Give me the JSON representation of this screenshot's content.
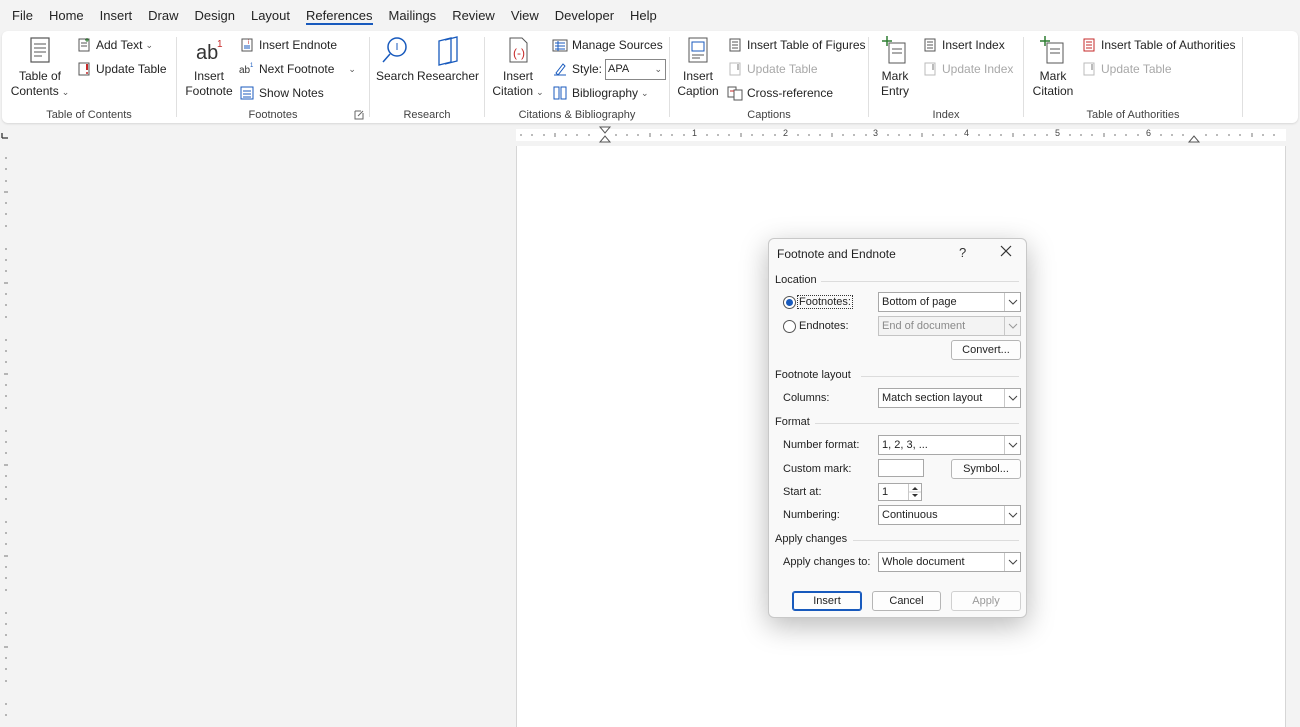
{
  "menu": {
    "items": [
      "File",
      "Home",
      "Insert",
      "Draw",
      "Design",
      "Layout",
      "References",
      "Mailings",
      "Review",
      "View",
      "Developer",
      "Help"
    ],
    "active": "References"
  },
  "ribbon": {
    "toc": {
      "label": "Table of Contents",
      "big_line1": "Table of",
      "big_line2": "Contents",
      "add_text": "Add Text",
      "update_table": "Update Table"
    },
    "footnotes": {
      "label": "Footnotes",
      "insert_line1": "Insert",
      "insert_line2": "Footnote",
      "insert_endnote": "Insert Endnote",
      "next_footnote": "Next Footnote",
      "show_notes": "Show Notes"
    },
    "research": {
      "label": "Research",
      "search": "Search",
      "researcher": "Researcher"
    },
    "citations": {
      "label": "Citations & Bibliography",
      "insert_line1": "Insert",
      "insert_line2": "Citation",
      "manage_sources": "Manage Sources",
      "style_label": "Style:",
      "style_value": "APA",
      "bibliography": "Bibliography"
    },
    "captions": {
      "label": "Captions",
      "insert_line1": "Insert",
      "insert_line2": "Caption",
      "insert_tof": "Insert Table of Figures",
      "update_table": "Update Table",
      "cross_reference": "Cross-reference"
    },
    "index": {
      "label": "Index",
      "mark_line1": "Mark",
      "mark_line2": "Entry",
      "insert_index": "Insert Index",
      "update_index": "Update Index"
    },
    "authorities": {
      "label": "Table of Authorities",
      "mark_line1": "Mark",
      "mark_line2": "Citation",
      "insert_toa": "Insert Table of Authorities",
      "update_table": "Update Table"
    }
  },
  "ruler": {
    "numbers": [
      "1",
      "2",
      "3",
      "4",
      "5",
      "6"
    ]
  },
  "dialog": {
    "title": "Footnote and Endnote",
    "help": "?",
    "location": {
      "section": "Location",
      "footnotes_label": "Footnotes:",
      "footnotes_value": "Bottom of page",
      "endnotes_label": "Endnotes:",
      "endnotes_value": "End of document",
      "convert": "Convert..."
    },
    "layout": {
      "section": "Footnote layout",
      "columns_label": "Columns:",
      "columns_value": "Match section layout"
    },
    "format": {
      "section": "Format",
      "number_format_label": "Number format:",
      "number_format_value": "1, 2, 3, ...",
      "custom_mark_label": "Custom mark:",
      "custom_mark_value": "",
      "symbol": "Symbol...",
      "start_at_label": "Start at:",
      "start_at_value": "1",
      "numbering_label": "Numbering:",
      "numbering_value": "Continuous"
    },
    "apply": {
      "section": "Apply changes",
      "apply_to_label": "Apply changes to:",
      "apply_to_value": "Whole document"
    },
    "buttons": {
      "insert": "Insert",
      "cancel": "Cancel",
      "apply": "Apply"
    }
  },
  "colors": {
    "accent": "#185abd",
    "ribbon_bg": "#ffffff",
    "chrome_bg": "#f3f3f3"
  }
}
